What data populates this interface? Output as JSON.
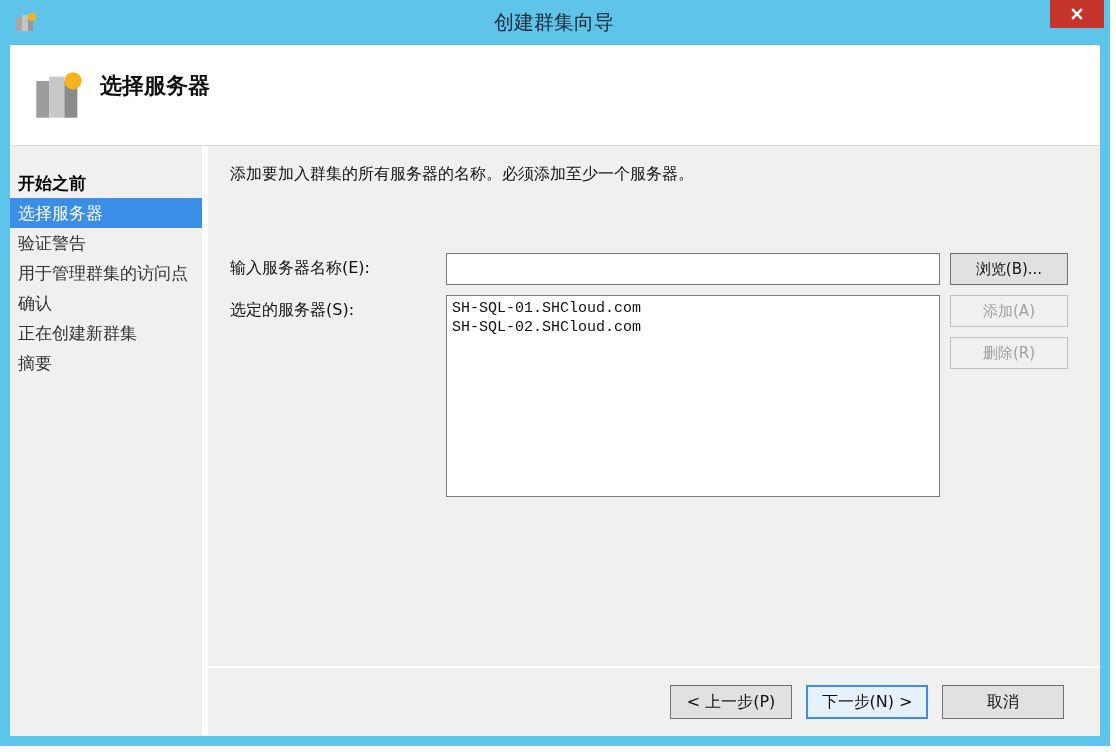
{
  "window": {
    "title": "创建群集向导"
  },
  "header": {
    "title": "选择服务器"
  },
  "sidebar": {
    "items": [
      {
        "label": "开始之前",
        "selected": false,
        "bold": true
      },
      {
        "label": "选择服务器",
        "selected": true,
        "bold": false
      },
      {
        "label": "验证警告",
        "selected": false,
        "bold": false
      },
      {
        "label": "用于管理群集的访问点",
        "selected": false,
        "bold": false
      },
      {
        "label": "确认",
        "selected": false,
        "bold": false
      },
      {
        "label": "正在创建新群集",
        "selected": false,
        "bold": false
      },
      {
        "label": "摘要",
        "selected": false,
        "bold": false
      }
    ]
  },
  "content": {
    "instruction": "添加要加入群集的所有服务器的名称。必须添加至少一个服务器。",
    "server_name": {
      "label": "输入服务器名称(E):",
      "browse_button": {
        "label": "浏览(B)...",
        "disabled": false
      }
    },
    "selected_servers": {
      "label": "选定的服务器(S):",
      "items": [
        "SH-SQL-01.SHCloud.com",
        "SH-SQL-02.SHCloud.com"
      ],
      "buttons": [
        {
          "label": "添加(A)",
          "disabled": true
        },
        {
          "label": "删除(R)",
          "disabled": true
        }
      ]
    }
  },
  "footer": {
    "buttons": [
      {
        "label": "< 上一步(P)",
        "default": false
      },
      {
        "label": "下一步(N) >",
        "default": true
      },
      {
        "label": "取消",
        "default": false
      }
    ]
  }
}
